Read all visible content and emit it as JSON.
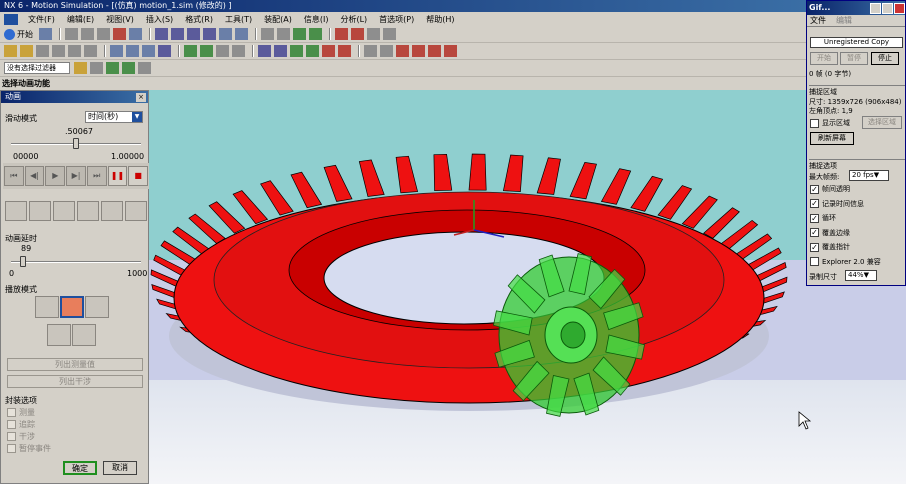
{
  "window": {
    "title": "NX 6 - Motion Simulation - [(仿真) motion_1.sim (修改的) ]"
  },
  "menu": [
    "文件(F)",
    "编辑(E)",
    "视图(V)",
    "插入(S)",
    "格式(R)",
    "工具(T)",
    "装配(A)",
    "信息(I)",
    "分析(L)",
    "首选项(P)",
    "帮助(H)"
  ],
  "toolbar": {
    "start_label": "开始",
    "selection_filter": "没有选择过滤器"
  },
  "status": {
    "prompt": "选择动画功能"
  },
  "dialog": {
    "title": "动画",
    "close_glyph": "×",
    "slide_mode_label": "滑动模式",
    "slide_mode_value": "时间(秒)",
    "slider_value": ".50067",
    "slider_min": "00000",
    "slider_max": "1.00000",
    "slider_fraction": 0.50067,
    "vcr_buttons": [
      "⏮",
      "◀|",
      "▶",
      "▶|",
      "⏭",
      "❚❚",
      "■"
    ],
    "delay_label": "动画延时",
    "delay_value": "89",
    "delay_min": "0",
    "delay_max": "1000",
    "delay_fraction": 0.089,
    "play_mode_label": "播放模式",
    "list_measures_button": "列出测量值",
    "list_interference_button": "列出干涉",
    "pause_options_label": "封装选项",
    "checks": [
      "测量",
      "追踪",
      "干涉",
      "暂停事件"
    ],
    "ok_label": "确定",
    "cancel_label": "取消"
  },
  "gif_recorder": {
    "title": "Gif...",
    "menu": [
      "文件",
      "编辑"
    ],
    "unregistered": "Unregistered Copy",
    "start_button": "开始",
    "pause_button": "暂停",
    "stop_button": "停止",
    "frames_info": "0 帧 (0 字节)",
    "capture_area_label": "捕捉区域",
    "size_text": "尺寸: 1359x726 (906x484)",
    "corner_text": "左角顶点:    1,9",
    "show_area_label": "显示区域",
    "select_area_button": "选择区域",
    "refresh_button": "刷新屏幕",
    "capture_options_label": "捕捉选项",
    "max_fps_label": "最大帧频:",
    "max_fps_value": "20 fps",
    "options": [
      {
        "label": "帧间透明",
        "checked": true
      },
      {
        "label": "记录时间信息",
        "checked": true
      },
      {
        "label": "循环",
        "checked": true
      },
      {
        "label": "覆盖边缘",
        "checked": true
      },
      {
        "label": "覆盖指针",
        "checked": true
      },
      {
        "label": "Explorer 2.0 兼容",
        "checked": false
      }
    ],
    "record_size_label": "录制尺寸",
    "record_size_value": "44%"
  },
  "colors": {
    "gear_red": "#ee1111",
    "pinion_green": "#33cc33",
    "viewport_top": "#8fcfcf"
  }
}
